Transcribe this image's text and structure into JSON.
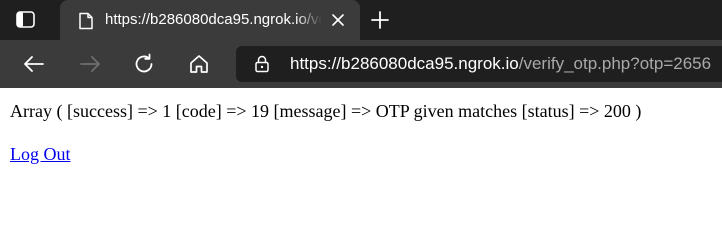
{
  "browser": {
    "tab": {
      "title": "https://b286080dca95.ngrok.io/verify_otp.php?otp=2656",
      "favicon": "page-icon",
      "close_icon": "close-icon"
    },
    "new_tab_icon": "plus-icon",
    "tab_actions_icon": "tab-actions-icon",
    "toolbar": {
      "back_icon": "arrow-left-icon",
      "forward_icon": "arrow-right-icon",
      "refresh_icon": "refresh-icon",
      "home_icon": "home-icon",
      "lock_icon": "lock-icon",
      "url_scheme": "https://",
      "url_host": "b286080dca95.ngrok.io",
      "url_path": "/verify_otp.php?otp=2656"
    },
    "colors": {
      "tabstrip_bg": "#1f1f1f",
      "active_tab_bg": "#3b3b3b",
      "omnibox_bg": "#1f1f1f",
      "url_muted": "#a9a9a9",
      "link": "#0000ee"
    }
  },
  "page": {
    "output_text": "Array ( [success] => 1 [code] => 19 [message] => OTP given matches [status] => 200 )",
    "logout_link": "Log Out"
  }
}
